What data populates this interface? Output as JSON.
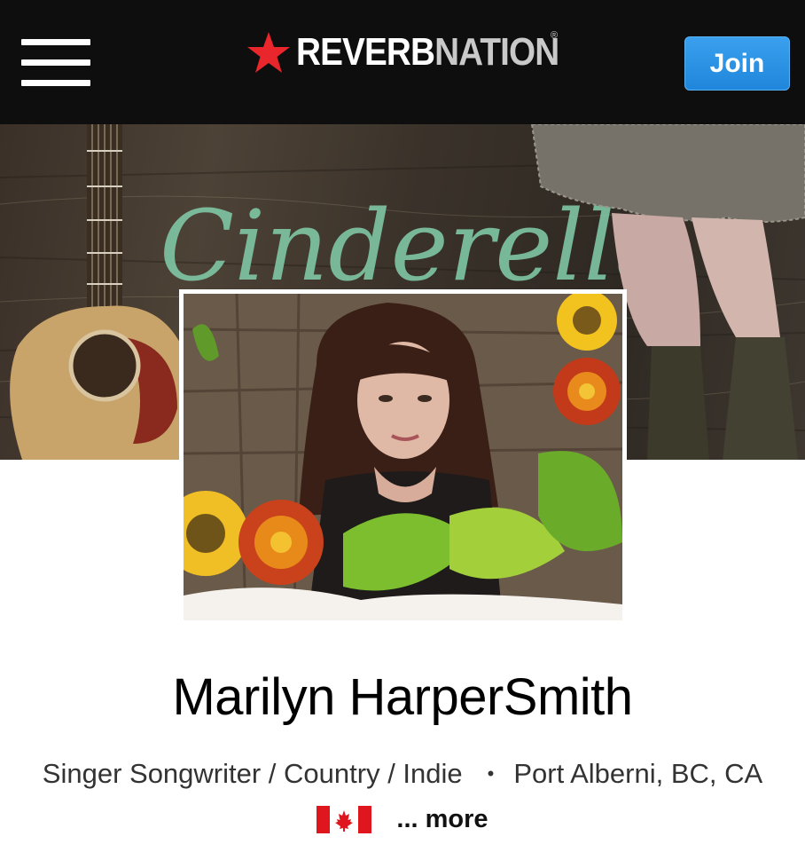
{
  "header": {
    "menu_icon": "hamburger-menu-icon",
    "logo": {
      "icon": "star-icon",
      "brand_part1": "REVERB",
      "brand_part2": "NATION",
      "registered_mark": "®",
      "star_color": "#e8262b"
    },
    "join_label": "Join",
    "join_color": "#2a90e0"
  },
  "banner": {
    "title_art": "Cinderella"
  },
  "artist": {
    "name": "Marilyn HarperSmith",
    "genres": "Singer Songwriter / Country / Indie",
    "separator": "•",
    "location": "Port Alberni, BC, CA",
    "country_flag": "canada-flag-icon",
    "more_label": "... more"
  }
}
